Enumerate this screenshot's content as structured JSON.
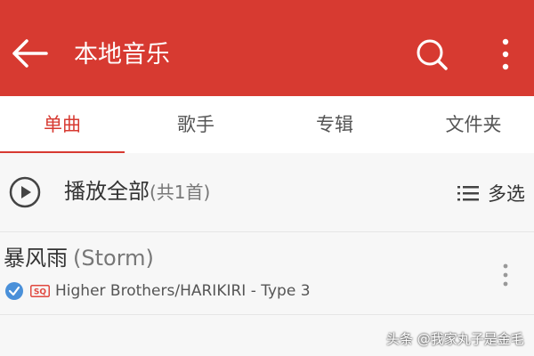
{
  "appbar": {
    "title": "本地音乐",
    "accent": "#d73a31"
  },
  "tabs": [
    {
      "label": "单曲",
      "active": true
    },
    {
      "label": "歌手",
      "active": false
    },
    {
      "label": "专辑",
      "active": false
    },
    {
      "label": "文件夹",
      "active": false
    }
  ],
  "playall": {
    "label": "播放全部",
    "count": "(共1首)",
    "multi_select": "多选"
  },
  "songs": [
    {
      "title": "暴风雨",
      "subtitle": "(Storm)",
      "quality_badge": "SQ",
      "artist_album": "Higher Brothers/HARIKIRI - Type 3",
      "downloaded": true
    }
  ],
  "watermark": "头条 @我家丸子是金毛",
  "icons": [
    "back-arrow-icon",
    "search-icon",
    "more-vertical-icon",
    "play-circle-icon",
    "list-icon",
    "check-circle-icon",
    "sq-badge-icon"
  ]
}
